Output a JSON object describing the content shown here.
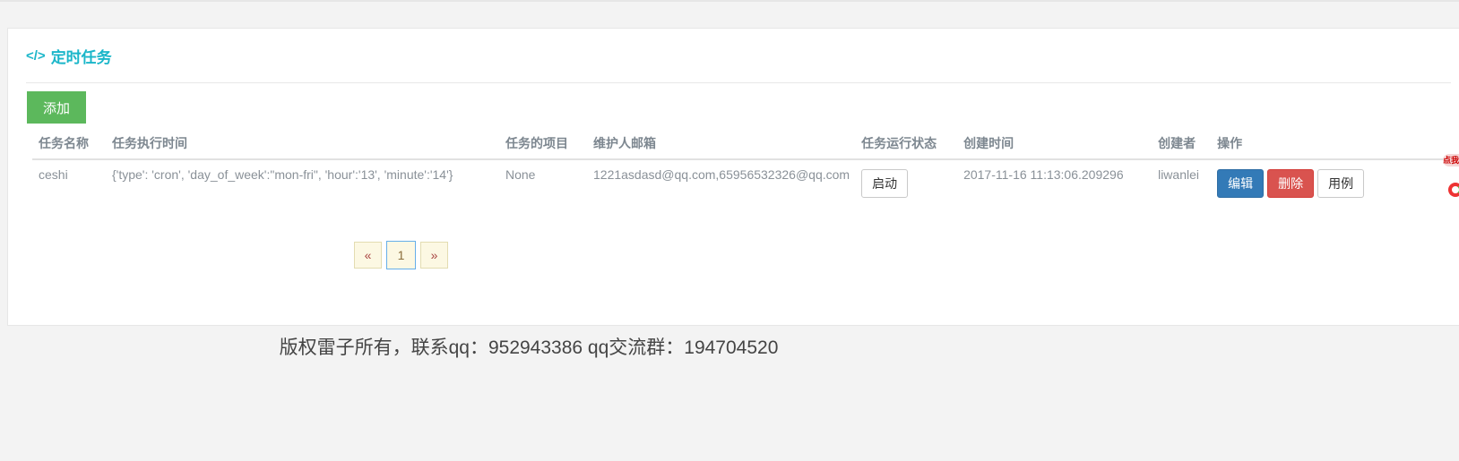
{
  "panel": {
    "title": "定时任务",
    "title_icon": "</>",
    "add_button": "添加"
  },
  "table": {
    "headers": [
      "任务名称",
      "任务执行时间",
      "任务的项目",
      "维护人邮箱",
      "任务运行状态",
      "创建时间",
      "创建者",
      "操作"
    ],
    "rows": [
      {
        "name": "ceshi",
        "schedule": "{'type': 'cron', 'day_of_week':\"mon-fri\", 'hour':'13', 'minute':'14'}",
        "project": "None",
        "emails": "1221asdasd@qq.com,65956532326@qq.com",
        "status_button": "启动",
        "created_at": "2017-11-16 11:13:06.209296",
        "creator": "liwanlei",
        "actions": {
          "edit": "编辑",
          "delete": "删除",
          "example": "用例"
        }
      }
    ]
  },
  "pagination": {
    "prev": "«",
    "current": "1",
    "next": "»"
  },
  "footer": "版权雷子所有，联系qq：952943386 qq交流群：194704520",
  "widget": {
    "label": "点我"
  },
  "colors": {
    "title": "#1ab6c9",
    "add_button": "#5cb85c",
    "edit_button": "#337ab7",
    "delete_button": "#d9534f"
  }
}
